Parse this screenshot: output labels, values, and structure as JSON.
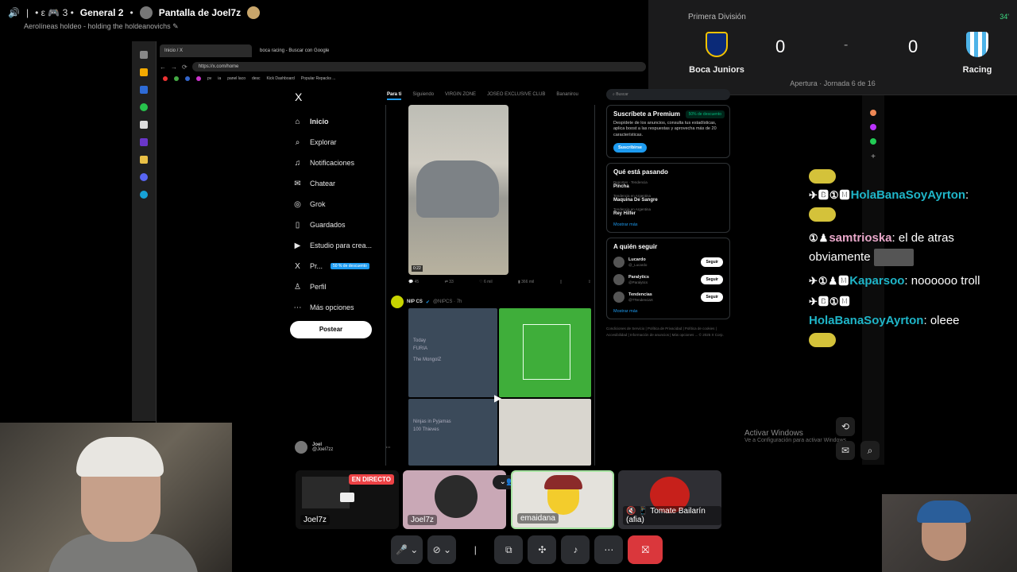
{
  "top": {
    "channel_prefix": "• ε 🎮 3 •",
    "channel": "General 2",
    "screen_title": "Pantalla de Joel7z",
    "subtitle": "Aerolíneas holdeo - holding the holdeanovichs"
  },
  "scoreboard": {
    "league": "Primera División",
    "minute": "34'",
    "home_team": "Boca Juniors",
    "away_team": "Racing",
    "home_score": "0",
    "separator": "-",
    "away_score": "0",
    "round": "Apertura · Jornada 6 de 16",
    "colors": {
      "boca_blue": "#0b2a78",
      "boca_gold": "#f2c200",
      "racing_blue": "#4db3e8"
    }
  },
  "browser": {
    "tabs": [
      "Inicio / X",
      "boca racing - Buscar con Google"
    ],
    "url": "https://x.com/home",
    "bookmarks": [
      "pv",
      "ia",
      "panel laco",
      "desc",
      "Kick Dashboard",
      "Popular Repacks ..."
    ]
  },
  "x": {
    "logo": "X",
    "nav": [
      {
        "label": "Inicio",
        "icon": "home-icon",
        "glyph": "⌂"
      },
      {
        "label": "Explorar",
        "icon": "search-icon",
        "glyph": "⌕"
      },
      {
        "label": "Notificaciones",
        "icon": "bell-icon",
        "glyph": "♫"
      },
      {
        "label": "Chatear",
        "icon": "mail-icon",
        "glyph": "✉"
      },
      {
        "label": "Grok",
        "icon": "grok-icon",
        "glyph": "◎"
      },
      {
        "label": "Guardados",
        "icon": "bookmark-icon",
        "glyph": "▯"
      },
      {
        "label": "Estudio para crea...",
        "icon": "studio-icon",
        "glyph": "▶"
      },
      {
        "label": "Pr...",
        "icon": "x-premium-icon",
        "glyph": "X"
      },
      {
        "label": "Perfil",
        "icon": "user-icon",
        "glyph": "♙"
      },
      {
        "label": "Más opciones",
        "icon": "more-icon",
        "glyph": "⋯"
      }
    ],
    "premium_badge": "50 % de descuento",
    "post_button": "Postear",
    "profile_name": "Joel",
    "profile_handle": "@Joel7zz",
    "feed_tabs": [
      "Para ti",
      "Siguiendo",
      "VIRGIN ZONE",
      "JOSEO EXCLUSIVE CLUB",
      "Bananirou"
    ],
    "video_duration": "0:22",
    "post_actions": [
      "45",
      "33",
      "6 mil",
      "366 mil"
    ],
    "post2_author": "NIP CS",
    "post2_handle": "@NIPCS · 7h",
    "grid_labels": [
      "Today",
      "FURIA",
      "The MongolZ",
      "Ninjas in Pyjamas",
      "100 Thieves"
    ],
    "search_placeholder": "Buscar",
    "premium": {
      "title": "Suscríbete a Premium",
      "discount": "50% de descuento",
      "text": "Despídete de los anuncios, consulta tus estadísticas, aplica boost a las respuestas y aprovecha más de 20 características.",
      "button": "Suscribirse"
    },
    "trending": {
      "title": "Qué está pasando",
      "items": [
        {
          "meta": "Deportes · Tendencia",
          "name": "Pincha"
        },
        {
          "meta": "Tendencia en Argentina",
          "name": "Maquina De Sangre"
        },
        {
          "meta": "Tendencia en Argentina",
          "name": "Rey Hilfer"
        }
      ],
      "more": "Mostrar más"
    },
    "follow": {
      "title": "A quién seguir",
      "items": [
        {
          "name": "Lucardo",
          "handle": "@_Lucardo"
        },
        {
          "name": "Paralytics",
          "handle": "@Paralytics"
        },
        {
          "name": "Tendencias",
          "handle": "@TTendenciaX"
        }
      ],
      "button": "Seguir",
      "more": "Mostrar más"
    },
    "footer": "Condiciones de Servicio | Política de Privacidad | Política de cookies | Accesibilidad | Información de anuncios | Más opciones ... © 2025 X Corp."
  },
  "chat": {
    "lines": [
      {
        "user": "HolaBanaSoyAyrton",
        "msg": ":"
      },
      {
        "user": "samtrioska",
        "msg": ": el de atras obviamente"
      },
      {
        "user": "Kaparsoo",
        "msg": ": noooooo troll"
      },
      {
        "user": "HolaBanaSoyAyrton",
        "msg": ": oleee"
      }
    ]
  },
  "windows": {
    "activate_title": "Activar Windows",
    "activate_sub": "Ve a Configuración para activar Windows."
  },
  "call": {
    "tiles": [
      {
        "name": "Joel7z",
        "live": "EN DIRECTO"
      },
      {
        "name": "Joel7z"
      },
      {
        "name": "emaidana"
      },
      {
        "name": "Tomate Bailarín (afia)"
      }
    ]
  }
}
